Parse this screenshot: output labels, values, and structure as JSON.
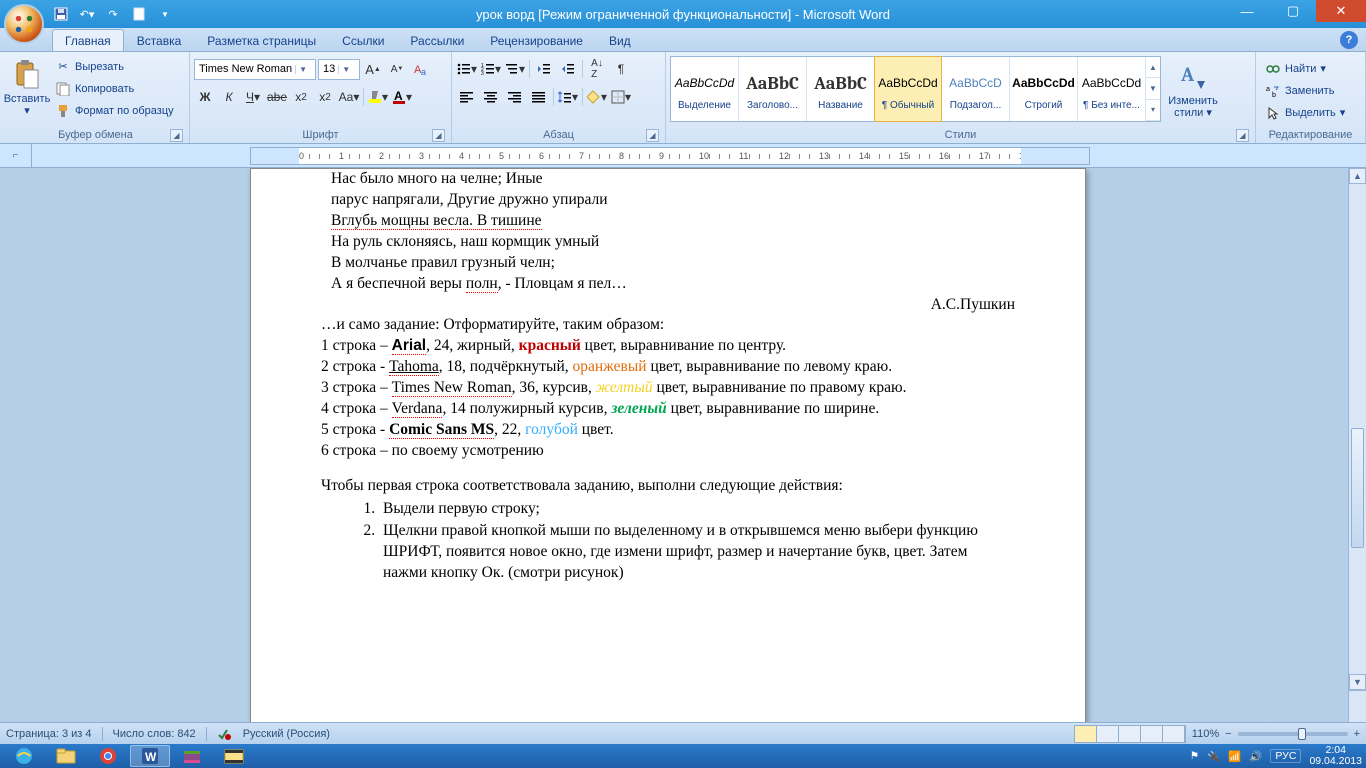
{
  "title": "урок ворд [Режим ограниченной функциональности] - Microsoft Word",
  "tabs": [
    "Главная",
    "Вставка",
    "Разметка страницы",
    "Ссылки",
    "Рассылки",
    "Рецензирование",
    "Вид"
  ],
  "active_tab": 0,
  "clipboard": {
    "group": "Буфер обмена",
    "paste": "Вставить",
    "cut": "Вырезать",
    "copy": "Копировать",
    "format_painter": "Формат по образцу"
  },
  "font": {
    "group": "Шрифт",
    "name": "Times New Roman",
    "size": "13"
  },
  "paragraph": {
    "group": "Абзац"
  },
  "styles": {
    "group": "Стили",
    "items": [
      {
        "sample": "AaBbCcDd",
        "name": "Выделение",
        "i": true
      },
      {
        "sample": "AaBbC",
        "name": "Заголово...",
        "big": true
      },
      {
        "sample": "AaBbC",
        "name": "Название",
        "big": true
      },
      {
        "sample": "AaBbCcDd",
        "name": "¶ Обычный"
      },
      {
        "sample": "AaBbCcD",
        "name": "Подзагол..."
      },
      {
        "sample": "AaBbCcDd",
        "name": "Строгий",
        "b": true
      },
      {
        "sample": "AaBbCcDd",
        "name": "¶ Без инте..."
      }
    ],
    "change": "Изменить стили"
  },
  "editing": {
    "group": "Редактирование",
    "find": "Найти",
    "replace": "Заменить",
    "select": "Выделить"
  },
  "doc": {
    "poem": [
      "Нас было много на челне; Иные",
      "парус напрягали, Другие дружно упирали",
      "Вглубь мощны весла. В тишине",
      "На руль склоняясь, наш кормщик умный",
      "В молчанье правил грузный челн;",
      "А я беспечной веры полн,  - Пловцам я пел…"
    ],
    "author": "А.С.Пушкин",
    "intro": "…и само задание: Отформатируйте, таким образом:",
    "lines": {
      "l1a": "1 строка – ",
      "l1b": "Arial",
      "l1c": ", 24, жирный, ",
      "l1d": "красный",
      "l1e": " цвет,  выравнивание по центру.",
      "l2a": "2 строка - ",
      "l2b": "Tahoma",
      "l2c": ", 18, подчёркнутый, ",
      "l2d": "оранжевый",
      "l2e": " цвет, выравнивание по левому краю.",
      "l3a": "3 строка – ",
      "l3b": "Times New Roman",
      "l3c": ", 36, курсив, ",
      "l3d": "желтый",
      "l3e": " цвет,  выравнивание по правому краю.",
      "l4a": "4 строка – ",
      "l4b": "Verdana",
      "l4c": ", 14 полужирный курсив, ",
      "l4d": "зеленый",
      "l4e": " цвет,  выравнивание по ширине.",
      "l5a": "5 строка - ",
      "l5b": "Comic Sans MS",
      "l5c": ", 22,  ",
      "l5d": "голубой",
      "l5e": " цвет.",
      "l6": "6 строка – по своему усмотрению"
    },
    "instr": "Чтобы первая строка соответствовала заданию, выполни следующие действия:",
    "step1": "Выдели первую строку;",
    "step2": "Щелкни правой кнопкой мыши по выделенному и в открывшемся меню выбери функцию ШРИФТ, появится новое окно, где измени шрифт, размер и начертание букв, цвет. Затем нажми кнопку Ок. (смотри рисунок)"
  },
  "status": {
    "page": "Страница: 3 из 4",
    "words": "Число слов: 842",
    "lang": "Русский (Россия)",
    "zoom": "110%"
  },
  "tray": {
    "lang": "РУС",
    "time": "2:04",
    "date": "09.04.2013"
  }
}
